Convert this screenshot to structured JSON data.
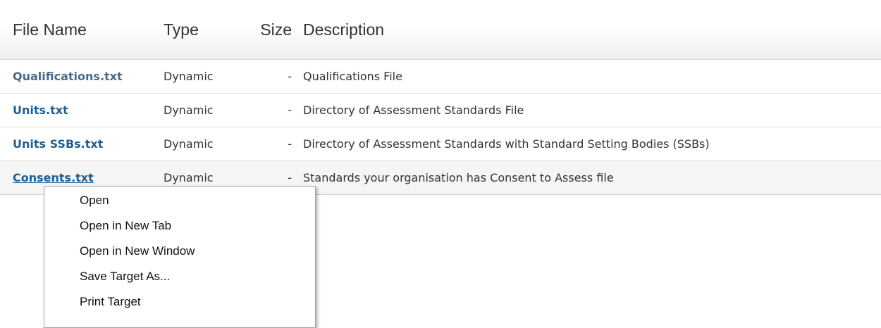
{
  "table": {
    "headers": {
      "name": "File Name",
      "type": "Type",
      "size": "Size",
      "description": "Description"
    },
    "rows": [
      {
        "name": "Qualifications.txt",
        "type": "Dynamic",
        "size": "-",
        "description": "Qualifications File"
      },
      {
        "name": "Units.txt",
        "type": "Dynamic",
        "size": "-",
        "description": "Directory of Assessment Standards File"
      },
      {
        "name": "Units SSBs.txt",
        "type": "Dynamic",
        "size": "-",
        "description": "Directory of Assessment Standards with Standard Setting Bodies (SSBs)"
      },
      {
        "name": "Consents.txt",
        "type": "Dynamic",
        "size": "-",
        "description": "Standards your organisation has Consent to Assess file"
      }
    ]
  },
  "context_menu": {
    "items": [
      {
        "label": "Open"
      },
      {
        "label": "Open in New Tab"
      },
      {
        "label": "Open in New Window"
      },
      {
        "label": "Save Target As..."
      },
      {
        "label": "Print Target"
      }
    ]
  }
}
